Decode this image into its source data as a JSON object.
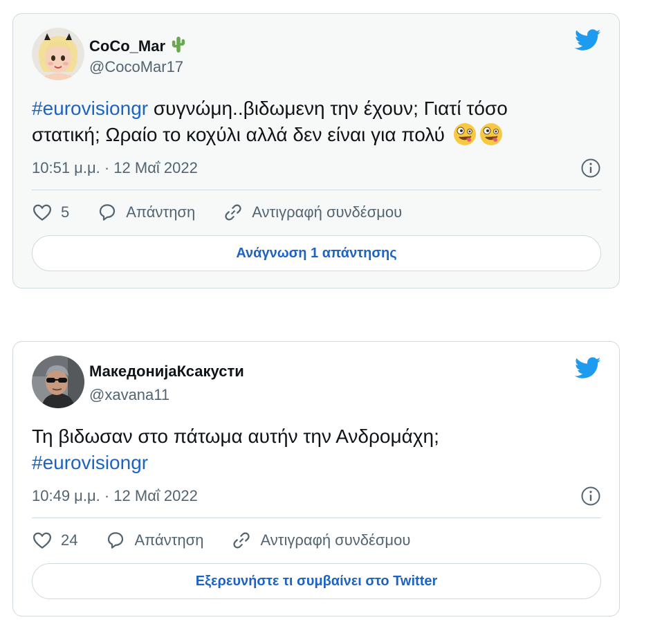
{
  "tweets": [
    {
      "display_name": "CoCo_Mar",
      "name_emoji": "cactus-icon",
      "handle": "@CocoMar17",
      "text_hashtag": "#eurovisiongr",
      "text_line1_rest": " συγνώμη..βιδωμενη την έχουν; Γιατί τόσο",
      "text_line2": "στατική; Ωραίο το κοχύλι αλλά δεν είναι για πολύ",
      "text_emojis": [
        "zany-face-emoji",
        "zany-face-emoji"
      ],
      "timestamp": "10:51 μ.μ. · 12 Μαΐ 2022",
      "likes": "5",
      "reply_label": "Απάντηση",
      "copy_link_label": "Αντιγραφή συνδέσμου",
      "cta_label": "Ανάγνωση 1 απάντησης"
    },
    {
      "display_name": "МакедонијаКсакусти",
      "handle": "@xavana11",
      "text_line1": "Τη βιδωσαν στο πάτωμα αυτήν την Ανδρομάχη;",
      "text_hashtag": "#eurovisiongr",
      "timestamp": "10:49 μ.μ. · 12 Μαΐ 2022",
      "likes": "24",
      "reply_label": "Απάντηση",
      "copy_link_label": "Αντιγραφή συνδέσμου",
      "cta_label": "Εξερευνήστε τι συμβαίνει στο Twitter"
    }
  ],
  "colors": {
    "twitter_blue": "#1d9bf0",
    "link_blue": "#1d63c4",
    "secondary_text": "#536471",
    "border": "#cfd9de"
  }
}
